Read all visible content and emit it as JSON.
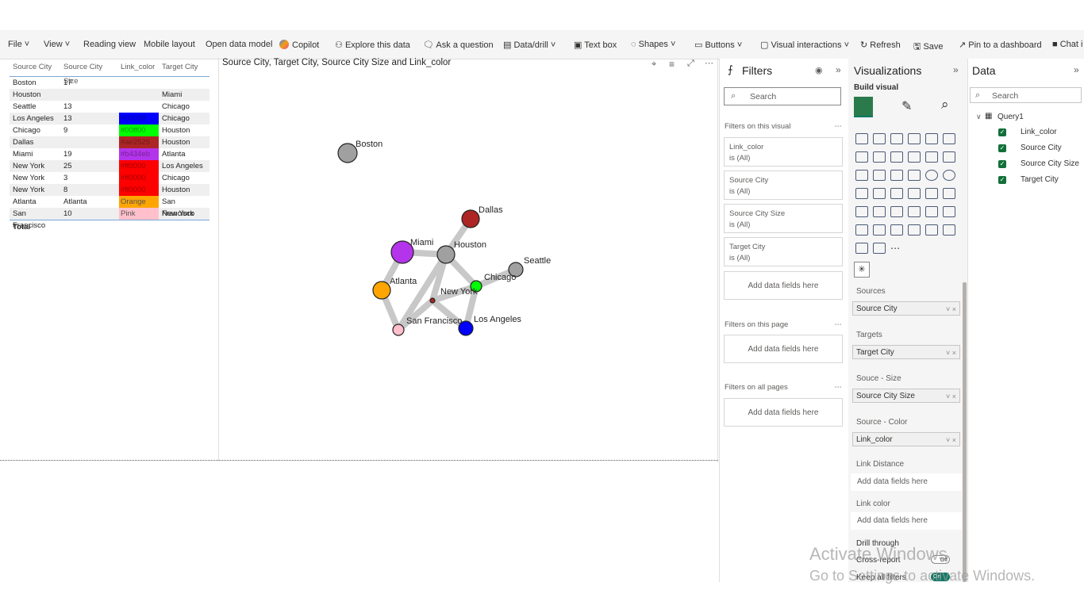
{
  "ribbon": {
    "items": [
      "File",
      "View",
      "Reading view",
      "Mobile layout",
      "Open data model",
      "Copilot",
      "Explore this data",
      "Ask a question",
      "Data/drill",
      "Text box",
      "Shapes",
      "Buttons",
      "Visual interactions",
      "Refresh",
      "Save",
      "Pin to a dashboard",
      "Chat i"
    ]
  },
  "table": {
    "headers": [
      "Source City",
      "Source City Size",
      "Link_color",
      "Target City"
    ],
    "rows": [
      {
        "source": "Boston",
        "size": "17",
        "color": "",
        "color_hex": "",
        "target": ""
      },
      {
        "source": "Houston",
        "size": "",
        "color": "",
        "color_hex": "",
        "target": "Miami"
      },
      {
        "source": "Seattle",
        "size": "13",
        "color": "",
        "color_hex": "",
        "target": "Chicago"
      },
      {
        "source": "Los Angeles",
        "size": "13",
        "color": "#0000ff",
        "color_hex": "#0000ff",
        "target": "Chicago"
      },
      {
        "source": "Chicago",
        "size": "9",
        "color": "#00ff00",
        "color_hex": "#00ff00",
        "target": "Houston"
      },
      {
        "source": "Dallas",
        "size": "",
        "color": "#ae2525",
        "color_hex": "#ae2525",
        "target": "Houston"
      },
      {
        "source": "Miami",
        "size": "19",
        "color": "#b434eb",
        "color_hex": "#b434eb",
        "target": "Atlanta"
      },
      {
        "source": "New York",
        "size": "25",
        "color": "#ff0000",
        "color_hex": "#ff0000",
        "target": "Los Angeles"
      },
      {
        "source": "New York",
        "size": "3",
        "color": "#ff0000",
        "color_hex": "#ff0000",
        "target": "Chicago"
      },
      {
        "source": "New York",
        "size": "8",
        "color": "#ff0000",
        "color_hex": "#ff0000",
        "target": "Houston"
      },
      {
        "source": "Atlanta",
        "size": "Atlanta",
        "color": "Orange",
        "color_hex": "#ffa500",
        "target": "San Francisco"
      },
      {
        "source": "San Francisco",
        "size": "10",
        "color": "Pink",
        "color_hex": "#ffc0cb",
        "target": "New York"
      }
    ],
    "total_label": "Total"
  },
  "network": {
    "title": "Source City, Target City, Source City Size and Link_color",
    "nodes": [
      {
        "name": "Boston",
        "color": "#a0a0a0"
      },
      {
        "name": "Dallas",
        "color": "#ae2525"
      },
      {
        "name": "Miami",
        "color": "#b434eb"
      },
      {
        "name": "Houston",
        "color": "#a0a0a0"
      },
      {
        "name": "Seattle",
        "color": "#a0a0a0"
      },
      {
        "name": "Atlanta",
        "color": "#ffa500"
      },
      {
        "name": "Chicago",
        "color": "#00ff00"
      },
      {
        "name": "New York",
        "color": "#ae2525"
      },
      {
        "name": "San Francisco",
        "color": "#ffc0cb"
      },
      {
        "name": "Los Angeles",
        "color": "#0000ff"
      }
    ]
  },
  "filters": {
    "title": "Filters",
    "search_placeholder": "Search",
    "on_visual": "Filters on this visual",
    "cards": [
      {
        "name": "Link_color",
        "state": "is (All)"
      },
      {
        "name": "Source City",
        "state": "is (All)"
      },
      {
        "name": "Source City Size",
        "state": "is (All)"
      },
      {
        "name": "Target City",
        "state": "is (All)"
      }
    ],
    "add_fields": "Add data fields here",
    "on_page": "Filters on this page",
    "on_all": "Filters on all pages"
  },
  "viz": {
    "title": "Visualizations",
    "build_visual": "Build visual",
    "wells": [
      {
        "label": "Sources",
        "value": "Source City"
      },
      {
        "label": "Targets",
        "value": "Target City"
      },
      {
        "label": "Souce - Size",
        "value": "Source City Size"
      },
      {
        "label": "Source - Color",
        "value": "Link_color"
      }
    ],
    "link_distance": "Link Distance",
    "link_color": "Link color",
    "add_fields": "Add data fields here",
    "drill_through": "Drill through",
    "cross_report": "Cross-report",
    "cross_state": "Off",
    "keep_filters": "Keep all filters",
    "keep_state": "On"
  },
  "data": {
    "title": "Data",
    "search_placeholder": "Search",
    "table": "Query1",
    "fields": [
      "Link_color",
      "Source City",
      "Source City Size",
      "Target City"
    ]
  },
  "watermark": {
    "line1": "Activate Windows",
    "line2": "Go to Settings to activate Windows."
  }
}
